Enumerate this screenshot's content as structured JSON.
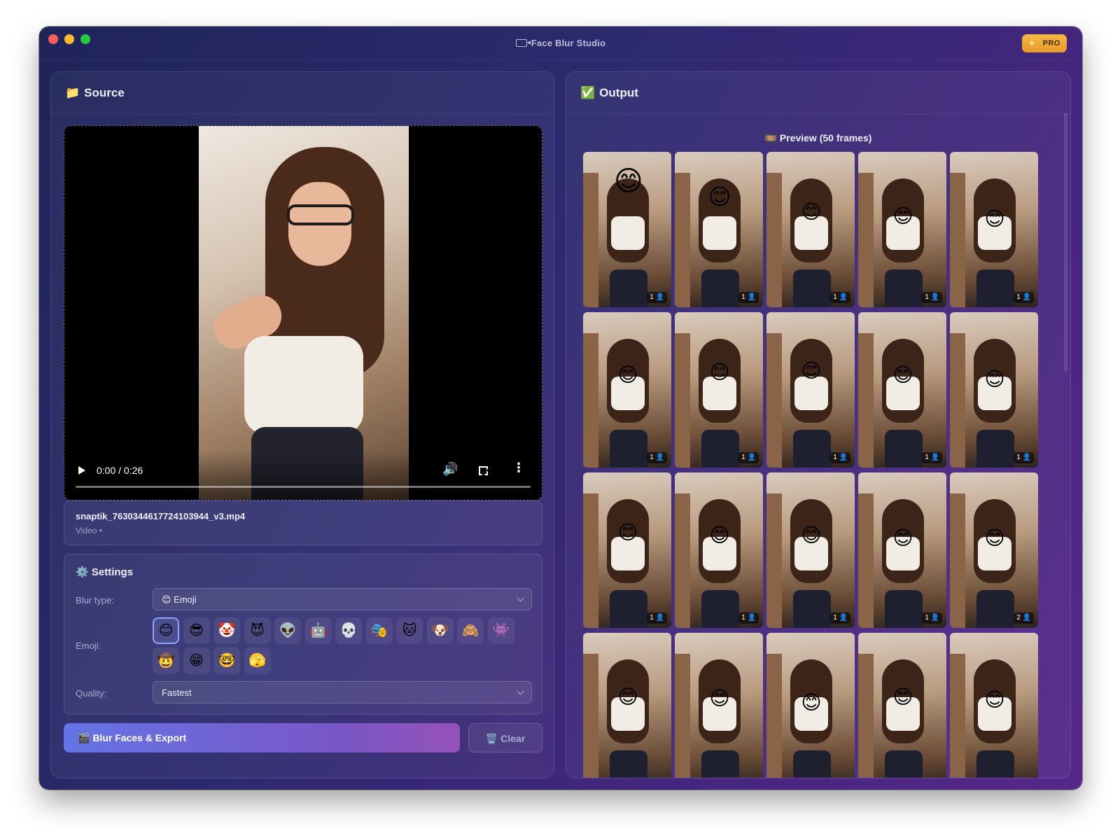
{
  "window": {
    "title": "Face Blur Studio",
    "pro_label": "PRO"
  },
  "source": {
    "heading": "Source",
    "heading_icon": "📁",
    "video": {
      "time": "0:00 / 0:26"
    },
    "file": {
      "name": "snaptik_7630344617724103944_v3.mp4",
      "meta": "Video •"
    }
  },
  "settings": {
    "heading": "Settings",
    "heading_icon": "⚙️",
    "blur_type_label": "Blur type:",
    "blur_type_value": "😊 Emoji",
    "emoji_label": "Emoji:",
    "emojis": [
      "😊",
      "😎",
      "🤡",
      "😈",
      "👽",
      "🤖",
      "💀",
      "🎭",
      "🐱",
      "🐶",
      "🙈",
      "👾",
      "🤠",
      "😁",
      "🤓",
      "🫣"
    ],
    "selected_emoji_index": 0,
    "quality_label": "Quality:",
    "quality_value": "Fastest"
  },
  "actions": {
    "export_label": "🎬 Blur Faces & Export",
    "clear_label": "🗑️ Clear"
  },
  "output": {
    "heading": "Output",
    "heading_icon": "✅",
    "preview_title": "🎞️ Preview (50 frames)",
    "frame_counts": [
      "1",
      "1",
      "1",
      "1",
      "1",
      "1",
      "1",
      "1",
      "1",
      "1",
      "1",
      "1",
      "1",
      "1",
      "2",
      "",
      "",
      "",
      "",
      ""
    ]
  }
}
